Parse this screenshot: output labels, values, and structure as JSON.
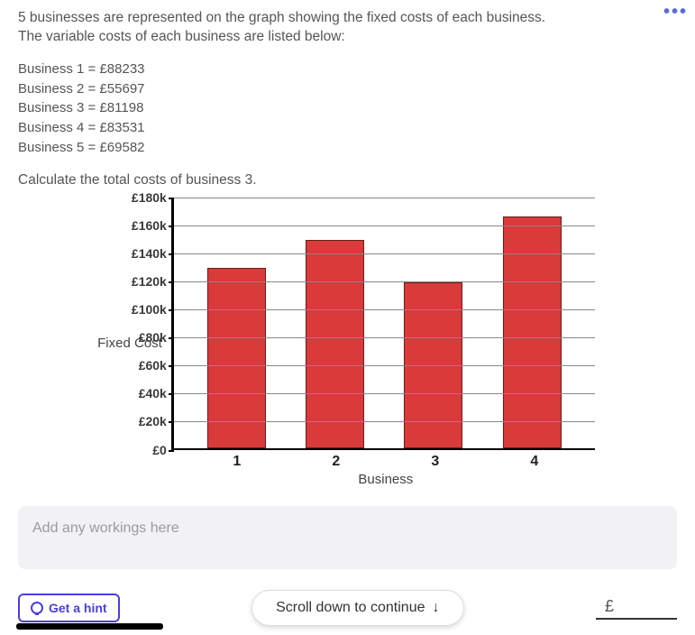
{
  "header": {
    "more_label": "•••"
  },
  "question": {
    "line1": "5 businesses are represented on the graph showing the fixed costs of each business.",
    "line2": "The variable costs of each business are listed below:",
    "variable_costs": [
      "Business 1 = £88233",
      "Business 2 = £55697",
      "Business 3 = £81198",
      "Business 4 = £83531",
      "Business 5 = £69582"
    ],
    "prompt": "Calculate the total costs of business 3."
  },
  "chart_data": {
    "type": "bar",
    "title": "",
    "ylabel": "Fixed Cost",
    "xlabel": "Business",
    "categories": [
      "1",
      "2",
      "3",
      "4"
    ],
    "values": [
      128000,
      148000,
      118000,
      165000
    ],
    "ylim": [
      0,
      180000
    ],
    "yticks": [
      "£0",
      "£20k",
      "£40k",
      "£60k",
      "£80k",
      "£100k",
      "£120k",
      "£140k",
      "£160k",
      "£180k"
    ]
  },
  "workings": {
    "placeholder": "Add any workings here"
  },
  "footer": {
    "hint_label": "Get a hint",
    "scroll_label": "Scroll down to continue",
    "scroll_arrow": "↓",
    "answer_prefix": "£"
  }
}
